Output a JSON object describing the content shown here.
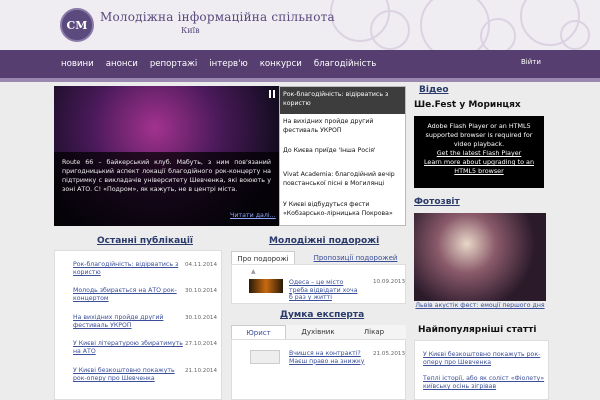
{
  "header": {
    "title": "Молодіжна інформаційна спільнота",
    "city": "Київ",
    "logo_text": "СМ"
  },
  "nav": {
    "items": [
      "новини",
      "анонси",
      "репортажі",
      "інтерв'ю",
      "конкурси",
      "благодійність"
    ],
    "login": "Війти"
  },
  "slider": {
    "caption": "Route 66 – байкерський клуб. Мабуть, з ним пов'язаний пригодницький аспект локації благодійного рок-концерту на підтримку с викладачів університету Шевченка, які воюють у зоні АТО. С! «Подром», як кажуть, не в центрі міста.",
    "more": "Читати далі...",
    "items": [
      "Рок-благодійність: відірватись з користю",
      "На вихідних пройде другий фестиваль УКРОП",
      "До Києва приїде 'Інша Росія'",
      "Vivat Academia: благодійний вечір повстанської пісні в Могилянці",
      "У Києві відбудуться фести «Кобзарсько-лірницька Покрова»"
    ]
  },
  "latest": {
    "title": "Останні публікації",
    "items": [
      {
        "title": "Рок-благодійність: відірватись з користю",
        "date": "04.11.2014"
      },
      {
        "title": "Молодь збирається на АТО рок-концертом",
        "date": "30.10.2014"
      },
      {
        "title": "На вихідних пройде другий фестиваль УКРОП",
        "date": "30.10.2014"
      },
      {
        "title": "У Києві літературою збиратимуть на АТО",
        "date": "27.10.2014"
      },
      {
        "title": "У Києві безкоштовно покажуть рок-оперу про Шевченка",
        "date": "21.10.2014"
      }
    ]
  },
  "trips": {
    "title": "Молодіжні подорожі",
    "tabs": [
      "Про подорожі",
      "Пропозиції подорожей"
    ],
    "item": {
      "title": "Одеса – це місто треба відвідати хоча б раз у житті",
      "date": "10.09.2013"
    }
  },
  "expert": {
    "title": "Думка експерта",
    "tabs": [
      "Юрист",
      "Духівник",
      "Лікар"
    ],
    "item": {
      "title": "Вчишся на контракті? Маєш право на знижку",
      "date": "21.05.2013"
    }
  },
  "video": {
    "title": "Відео",
    "subtitle": "Ше.Fest у Моринцях",
    "message": "Adobe Flash Player or an HTML5 supported browser is required for video playback.",
    "link1": "Get the latest Flash Player",
    "link2": "Learn more about upgrading to an HTML5 browser"
  },
  "photo": {
    "title": "Фотозвіт",
    "caption": "Львів акустік фест: емоції першого дня"
  },
  "popular": {
    "title": "Найпопулярніші статті",
    "items": [
      "У Києві безкоштовно покажуть рок-оперу про Шевченка",
      "Теплі історії, або як соліст «Фіолету» київську осінь зігрівав"
    ]
  }
}
